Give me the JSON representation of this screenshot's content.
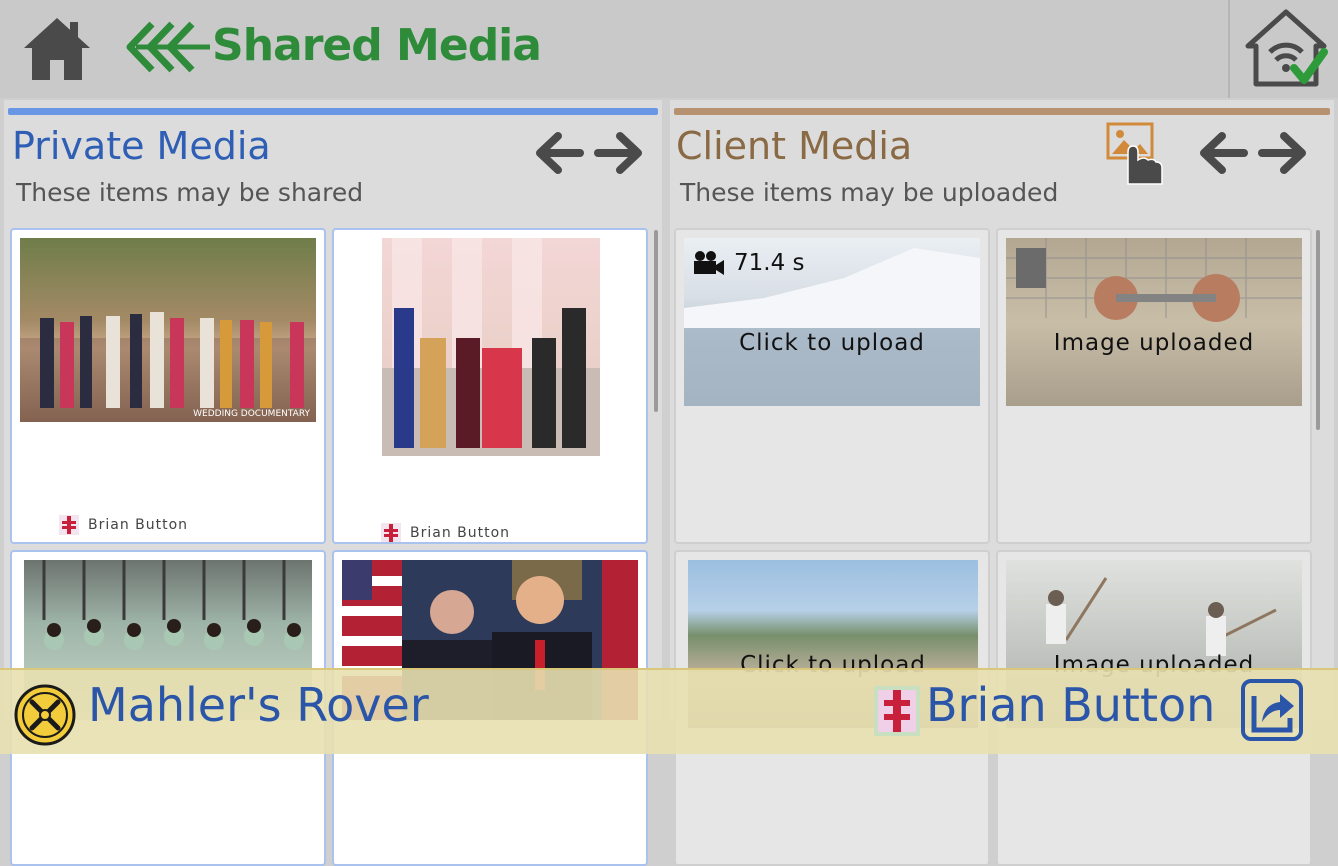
{
  "header": {
    "title": "Shared Media",
    "icons": {
      "home": "home-icon",
      "back": "double-chevron-left-icon",
      "status": "home-wifi-check-icon"
    },
    "accent_color": "#2e8b3a"
  },
  "private_panel": {
    "title": "Private Media",
    "subtitle": "These items may be shared",
    "accent_color": "#2f5fb5",
    "items": [
      {
        "owner": "Brian Button"
      },
      {
        "owner": "Brian Button"
      },
      {},
      {}
    ]
  },
  "client_panel": {
    "title": "Client Media",
    "subtitle": "These items may be uploaded",
    "accent_color": "#8a6a44",
    "items": [
      {
        "duration": "71.4 s",
        "status": "Click to upload"
      },
      {
        "status": "Image uploaded"
      },
      {
        "status": "Click to upload"
      },
      {
        "status": "Image uploaded"
      }
    ]
  },
  "footer": {
    "client_name": "Mahler's Rover",
    "user_name": "Brian Button",
    "icons": {
      "client": "client-logo-icon",
      "user": "user-badge-icon",
      "share": "share-icon"
    }
  }
}
